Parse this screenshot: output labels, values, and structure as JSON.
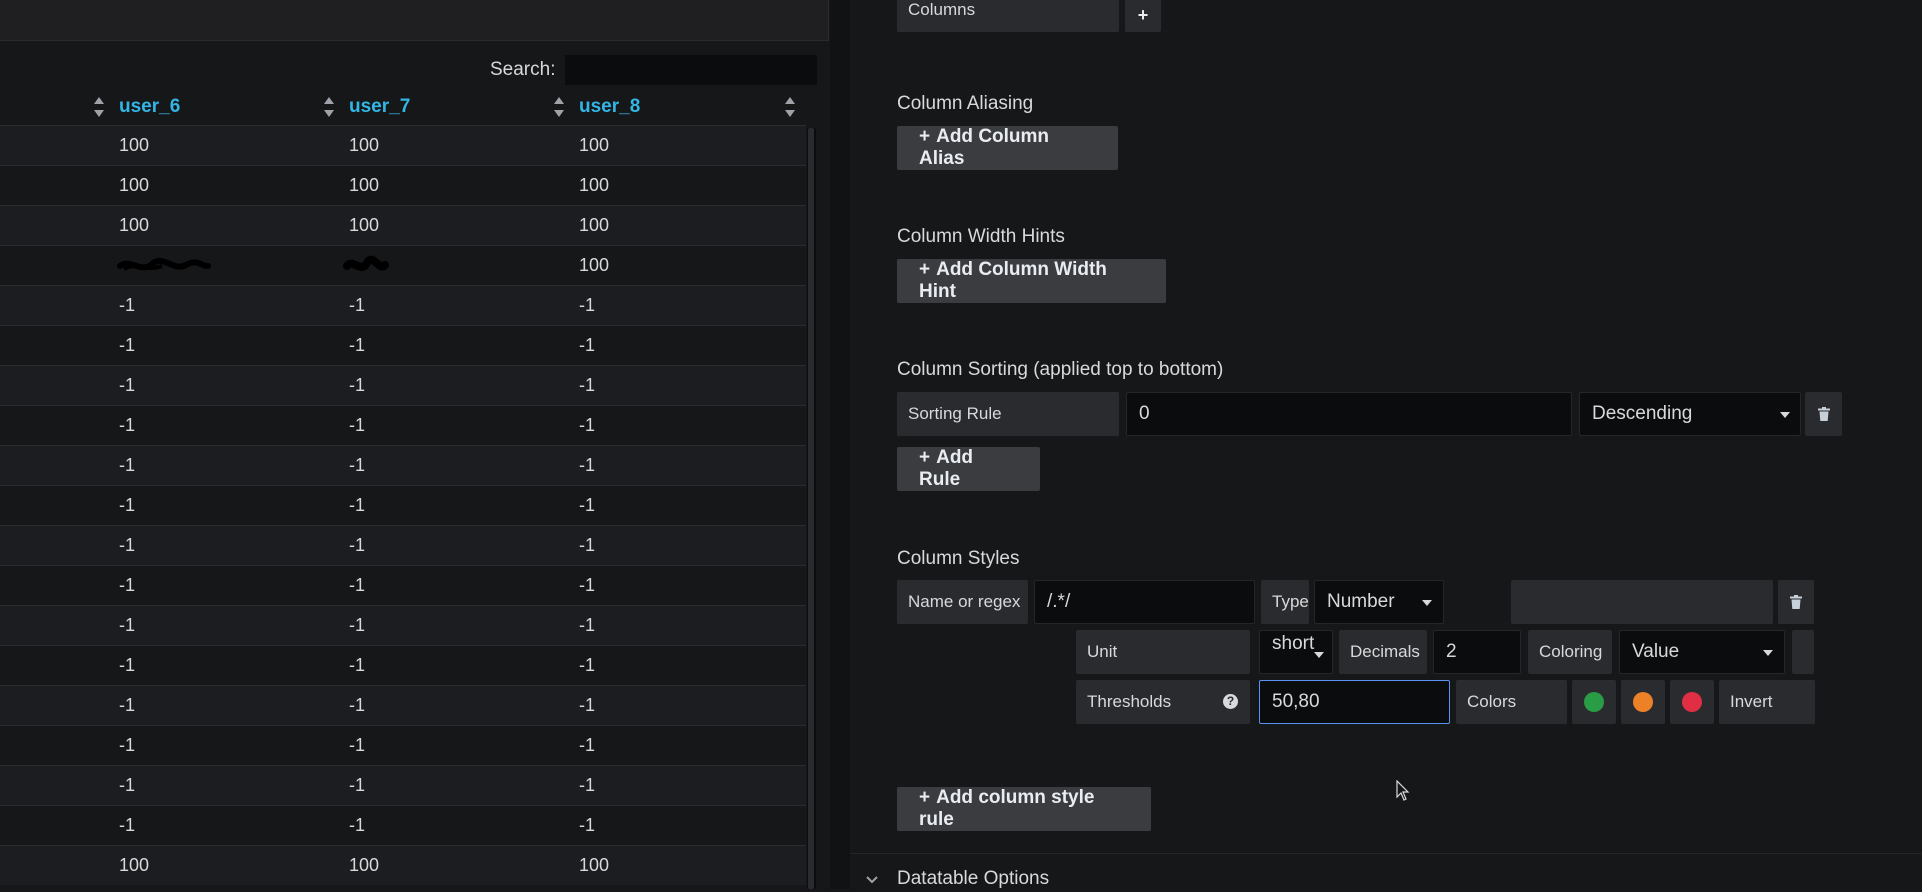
{
  "search": {
    "label": "Search:",
    "value": ""
  },
  "table": {
    "columns": [
      {
        "label": "user_6"
      },
      {
        "label": "user_7"
      },
      {
        "label": "user_8"
      }
    ],
    "rows": [
      [
        "100",
        "100",
        "100"
      ],
      [
        "100",
        "100",
        "100"
      ],
      [
        "100",
        "100",
        "100"
      ],
      [
        "",
        "",
        "100"
      ],
      [
        "-1",
        "-1",
        "-1"
      ],
      [
        "-1",
        "-1",
        "-1"
      ],
      [
        "-1",
        "-1",
        "-1"
      ],
      [
        "-1",
        "-1",
        "-1"
      ],
      [
        "-1",
        "-1",
        "-1"
      ],
      [
        "-1",
        "-1",
        "-1"
      ],
      [
        "-1",
        "-1",
        "-1"
      ],
      [
        "-1",
        "-1",
        "-1"
      ],
      [
        "-1",
        "-1",
        "-1"
      ],
      [
        "-1",
        "-1",
        "-1"
      ],
      [
        "-1",
        "-1",
        "-1"
      ],
      [
        "-1",
        "-1",
        "-1"
      ],
      [
        "-1",
        "-1",
        "-1"
      ],
      [
        "-1",
        "-1",
        "-1"
      ],
      [
        "100",
        "100",
        "100"
      ]
    ]
  },
  "options": {
    "columns_label": "Columns",
    "aliasing": {
      "title": "Column Aliasing",
      "button": "Add Column Alias"
    },
    "width_hints": {
      "title": "Column Width Hints",
      "button": "Add Column Width Hint"
    },
    "sorting": {
      "title": "Column Sorting (applied top to bottom)",
      "rule_label": "Sorting Rule",
      "rule_value": "0",
      "order": "Descending",
      "add_button": "Add Rule"
    },
    "styles": {
      "title": "Column Styles",
      "name_label": "Name or regex",
      "name_value": "/.*/",
      "type_label": "Type",
      "type_value": "Number",
      "unit_label": "Unit",
      "unit_value": "short",
      "decimals_label": "Decimals",
      "decimals_value": "2",
      "coloring_label": "Coloring",
      "coloring_value": "Value",
      "thresholds_label": "Thresholds",
      "thresholds_value": "50,80",
      "colors_label": "Colors",
      "invert_label": "Invert",
      "add_button": "Add column style rule"
    },
    "datatable_options": "Datatable Options"
  },
  "colors": {
    "accent": "#33b5e5",
    "threshold_ok": "#299c46",
    "threshold_warn": "#ed8128",
    "threshold_crit": "#e02f44",
    "focus_border": "#5794f2"
  }
}
